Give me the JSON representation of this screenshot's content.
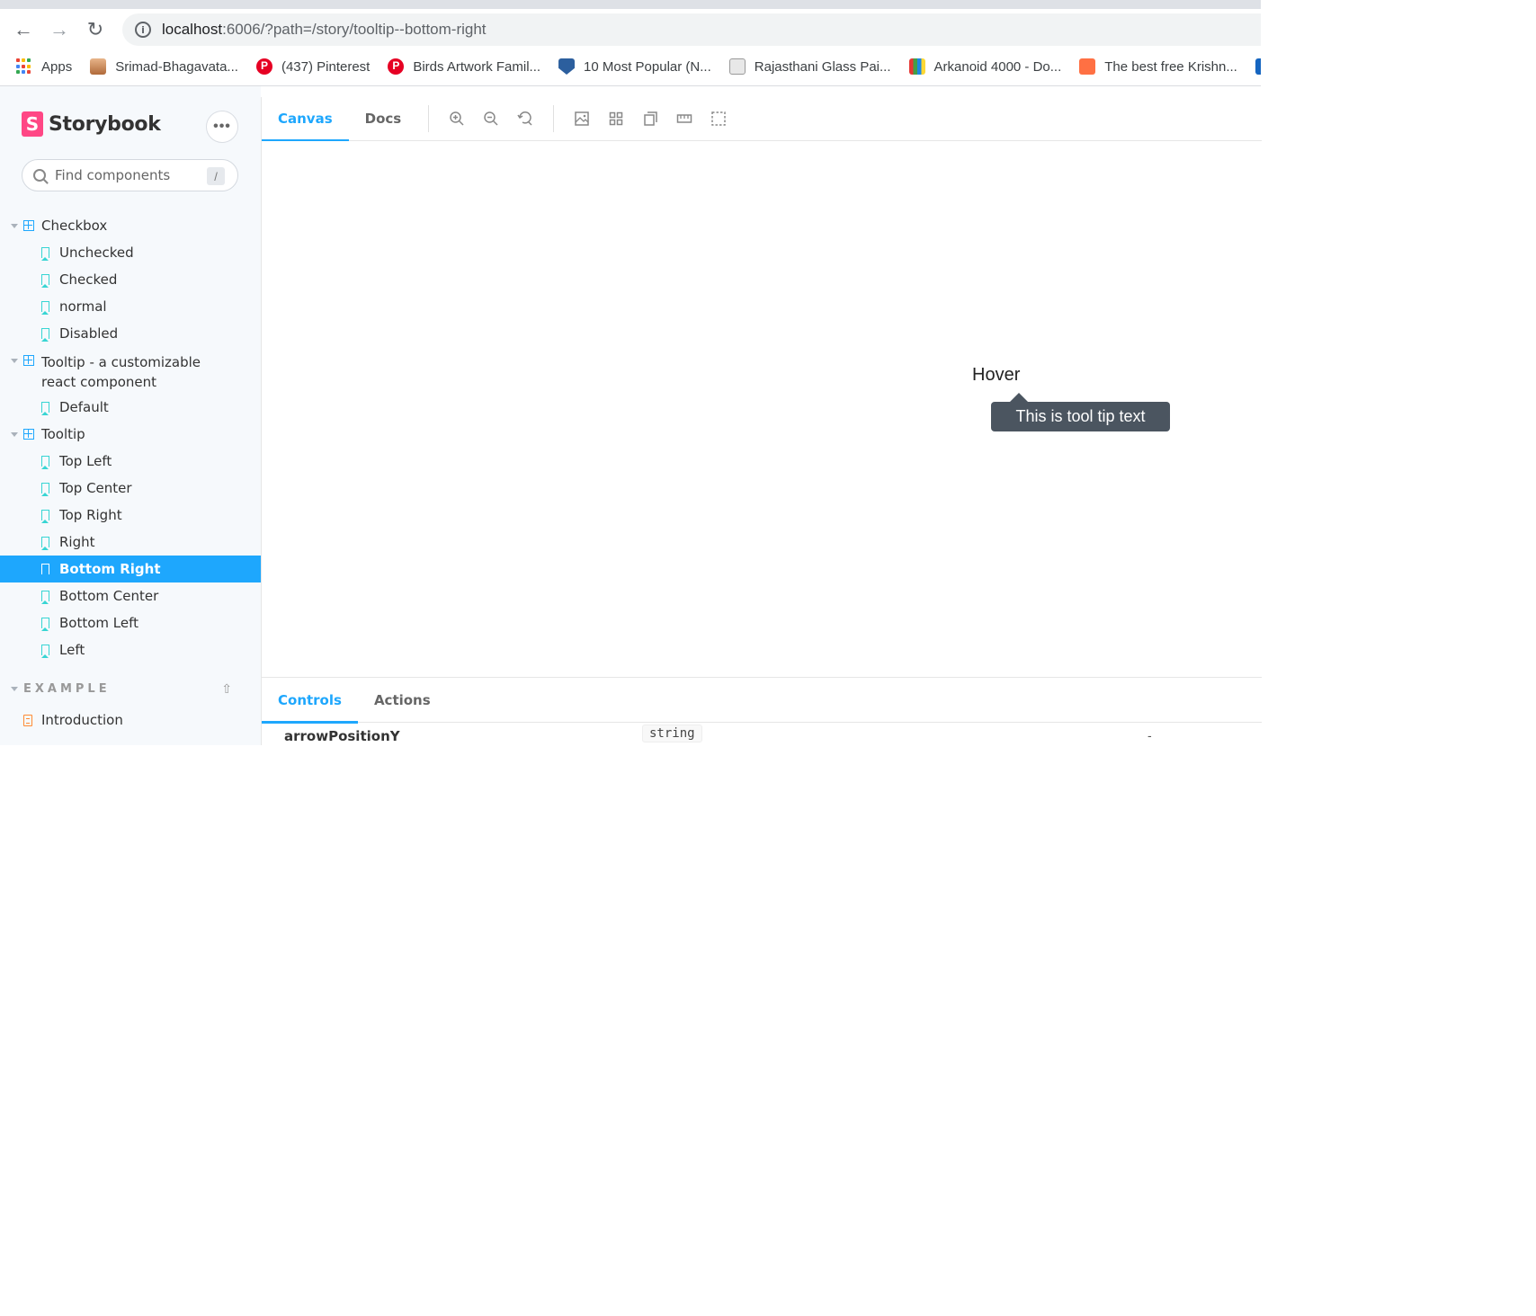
{
  "browser": {
    "url_host": "localhost",
    "url_rest": ":6006/?path=/story/tooltip--bottom-right",
    "bookmarks": [
      {
        "label": "Apps",
        "icon": "apps-grid-icon"
      },
      {
        "label": "Srimad-Bhagavata...",
        "icon": "person-icon"
      },
      {
        "label": "(437) Pinterest",
        "icon": "pinterest-icon"
      },
      {
        "label": "Birds Artwork Famil...",
        "icon": "pinterest-icon"
      },
      {
        "label": "10 Most Popular (N...",
        "icon": "shield-icon"
      },
      {
        "label": "Rajasthani Glass Pai...",
        "icon": "search-icon"
      },
      {
        "label": "Arkanoid 4000 - Do...",
        "icon": "game-icon"
      },
      {
        "label": "The best free Krishn...",
        "icon": "krishna-icon"
      }
    ]
  },
  "sidebar": {
    "brand": "Storybook",
    "brand_logo_letter": "S",
    "search_placeholder": "Find components",
    "search_shortcut": "/",
    "tree": [
      {
        "type": "component",
        "label": "Checkbox"
      },
      {
        "type": "story",
        "label": "Unchecked"
      },
      {
        "type": "story",
        "label": "Checked"
      },
      {
        "type": "story",
        "label": "normal"
      },
      {
        "type": "story",
        "label": "Disabled"
      },
      {
        "type": "component",
        "label": "Tooltip - a customizable react component"
      },
      {
        "type": "story",
        "label": "Default"
      },
      {
        "type": "component",
        "label": "Tooltip"
      },
      {
        "type": "story",
        "label": "Top Left"
      },
      {
        "type": "story",
        "label": "Top Center"
      },
      {
        "type": "story",
        "label": "Top Right"
      },
      {
        "type": "story",
        "label": "Right"
      },
      {
        "type": "story",
        "label": "Bottom Right",
        "selected": true
      },
      {
        "type": "story",
        "label": "Bottom Center"
      },
      {
        "type": "story",
        "label": "Bottom Left"
      },
      {
        "type": "story",
        "label": "Left"
      }
    ],
    "section": {
      "title": "EXAMPLE",
      "items": [
        {
          "type": "doc",
          "label": "Introduction"
        }
      ]
    }
  },
  "toolbar": {
    "tabs": [
      "Canvas",
      "Docs"
    ],
    "active_tab": "Canvas",
    "icons": [
      "zoom-in-icon",
      "zoom-out-icon",
      "zoom-reset-icon",
      "background-icon",
      "grid-icon",
      "viewport-icon",
      "measure-icon",
      "outline-icon"
    ]
  },
  "canvas": {
    "hover_label": "Hover",
    "tooltip_text": "This is tool tip text"
  },
  "addons": {
    "tabs": [
      "Controls",
      "Actions"
    ],
    "active_tab": "Controls",
    "row": {
      "name": "arrowPositionY",
      "type": "string",
      "default": "-"
    }
  },
  "colors": {
    "accent": "#1ea7fd",
    "storybook_pink": "#ff4785",
    "story_icon": "#37d5d3",
    "tooltip_bg": "#4b5560"
  }
}
